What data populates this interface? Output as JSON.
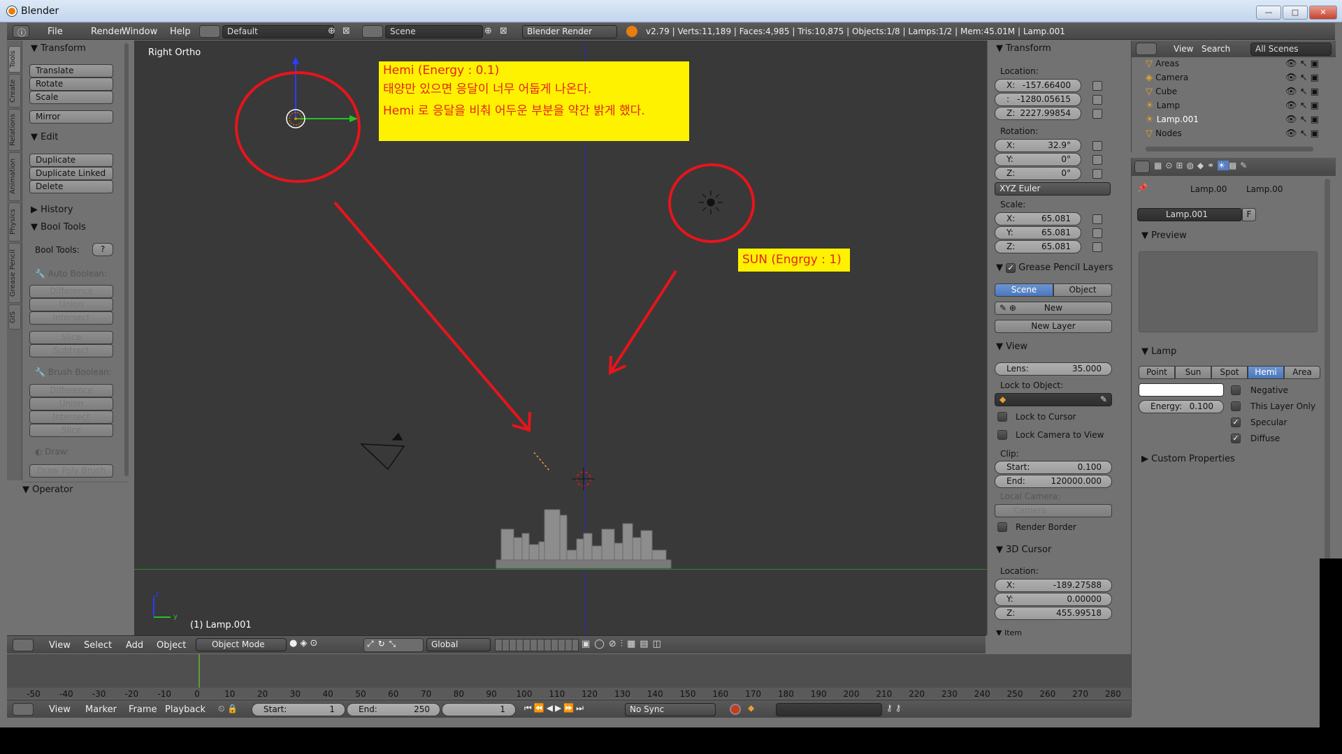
{
  "window": {
    "title": "Blender",
    "minimize": "—",
    "maximize": "□",
    "close": "✕"
  },
  "menu": {
    "file": "File",
    "render": "Render",
    "window": "Window",
    "help": "Help"
  },
  "infobar": {
    "layout": "Default",
    "scene": "Scene",
    "engine": "Blender Render",
    "stats": "v2.79 | Verts:11,189 | Faces:4,985 | Tris:10,875 | Objects:1/8 | Lamps:1/2 | Mem:45.01M | Lamp.001"
  },
  "vtabs": [
    "Tools",
    "Create",
    "Relations",
    "Animation",
    "Physics",
    "Grease Pencil",
    "GIS"
  ],
  "toolshelf": {
    "transform_header": "Transform",
    "translate": "Translate",
    "rotate": "Rotate",
    "scale": "Scale",
    "mirror": "Mirror",
    "edit_header": "Edit",
    "duplicate": "Duplicate",
    "duplicate_linked": "Duplicate Linked",
    "delete": "Delete",
    "history_header": "History",
    "bool_header": "Bool Tools",
    "bool_tools_label": "Bool Tools:",
    "help_q": "?",
    "auto_boolean": "Auto Boolean:",
    "difference": "Difference",
    "union": "Union",
    "intersect": "Intersect",
    "slice": "Slice",
    "subtract": "Subtract",
    "brush_boolean": "Brush Boolean:",
    "difference2": "Difference",
    "union2": "Union",
    "intersect2": "Intersect",
    "slice2": "Slice",
    "draw": "Draw:",
    "draw_poly": "Draw Poly Brush",
    "operator_header": "Operator"
  },
  "viewport": {
    "view_name": "Right Ortho",
    "active_object": "(1) Lamp.001",
    "note_hemi": {
      "line1": "Hemi (Energy : 0.1)",
      "line2": "태양만 있으면 응달이 너무 어둡게 나온다.",
      "line3": "Hemi 로 응달을 비춰 어두운 부분을 약간 밝게 했다."
    },
    "note_sun": "SUN (Engrgy : 1)",
    "axis_z": "z",
    "axis_y": "y"
  },
  "npanel": {
    "transform_header": "Transform",
    "location_label": "Location:",
    "loc_x": {
      "k": "X:",
      "v": "-157.66400"
    },
    "loc_y": {
      "k": ":",
      "v": "-1280.05615"
    },
    "loc_z": {
      "k": "Z:",
      "v": "2227.99854"
    },
    "rotation_label": "Rotation:",
    "rot_x": {
      "k": "X:",
      "v": "32.9°"
    },
    "rot_y": {
      "k": "Y:",
      "v": "0°"
    },
    "rot_z": {
      "k": "Z:",
      "v": "0°"
    },
    "rotation_mode": "XYZ Euler",
    "scale_label": "Scale:",
    "scale_x": {
      "k": "X:",
      "v": "65.081"
    },
    "scale_y": {
      "k": "Y:",
      "v": "65.081"
    },
    "scale_z": {
      "k": "Z:",
      "v": "65.081"
    },
    "gp_header": "Grease Pencil Layers",
    "gp_scene": "Scene",
    "gp_object": "Object",
    "gp_new": "New",
    "gp_new_layer": "New Layer",
    "view_header": "View",
    "lens": {
      "k": "Lens:",
      "v": "35.000"
    },
    "lock_to_object": "Lock to Object:",
    "lock_to_cursor": "Lock to Cursor",
    "lock_camera": "Lock Camera to View",
    "clip_label": "Clip:",
    "clip_start": {
      "k": "Start:",
      "v": "0.100"
    },
    "clip_end": {
      "k": "End:",
      "v": "120000.000"
    },
    "local_camera": "Local Camera:",
    "camera_field": "Camera",
    "render_border": "Render Border",
    "cursor_header": "3D Cursor",
    "cursor_location": "Location:",
    "cur_x": {
      "k": "X:",
      "v": "-189.27588"
    },
    "cur_y": {
      "k": "Y:",
      "v": "0.00000"
    },
    "cur_z": {
      "k": "Z:",
      "v": "455.99518"
    },
    "item_header": "Item"
  },
  "outliner": {
    "view": "View",
    "search": "Search",
    "filter": "All Scenes",
    "items": [
      "Areas",
      "Camera",
      "Cube",
      "Lamp",
      "Lamp.001",
      "Nodes"
    ]
  },
  "properties": {
    "breadcrumb1": "Lamp.00",
    "breadcrumb2": "Lamp.00",
    "datablock": "Lamp.001",
    "fake_user": "F",
    "preview_header": "Preview",
    "lamp_header": "Lamp",
    "types": [
      "Point",
      "Sun",
      "Spot",
      "Hemi",
      "Area"
    ],
    "active_type": "Hemi",
    "negative": "Negative",
    "this_layer_only": "This Layer Only",
    "specular": "Specular",
    "diffuse": "Diffuse",
    "energy": {
      "k": "Energy:",
      "v": "0.100"
    },
    "custom_props": "Custom Properties"
  },
  "view3d_header": {
    "view": "View",
    "select": "Select",
    "add": "Add",
    "object": "Object",
    "mode": "Object Mode",
    "orientation": "Global"
  },
  "timeline": {
    "ticks": [
      -50,
      -40,
      -30,
      -20,
      -10,
      0,
      10,
      20,
      30,
      40,
      50,
      60,
      70,
      80,
      90,
      100,
      110,
      120,
      130,
      140,
      150,
      160,
      170,
      180,
      190,
      200,
      210,
      220,
      230,
      240,
      250,
      260,
      270,
      280
    ],
    "current_frame": 0
  },
  "timeline_header": {
    "view": "View",
    "marker": "Marker",
    "frame": "Frame",
    "playback": "Playback",
    "start": {
      "k": "Start:",
      "v": "1"
    },
    "end": {
      "k": "End:",
      "v": "250"
    },
    "current": "1",
    "sync": "No Sync"
  },
  "colors": {
    "accent_blue": "#5680c2",
    "note_yellow": "#fff200",
    "note_red": "#e2231a",
    "annotation_red": "#e8141b"
  }
}
